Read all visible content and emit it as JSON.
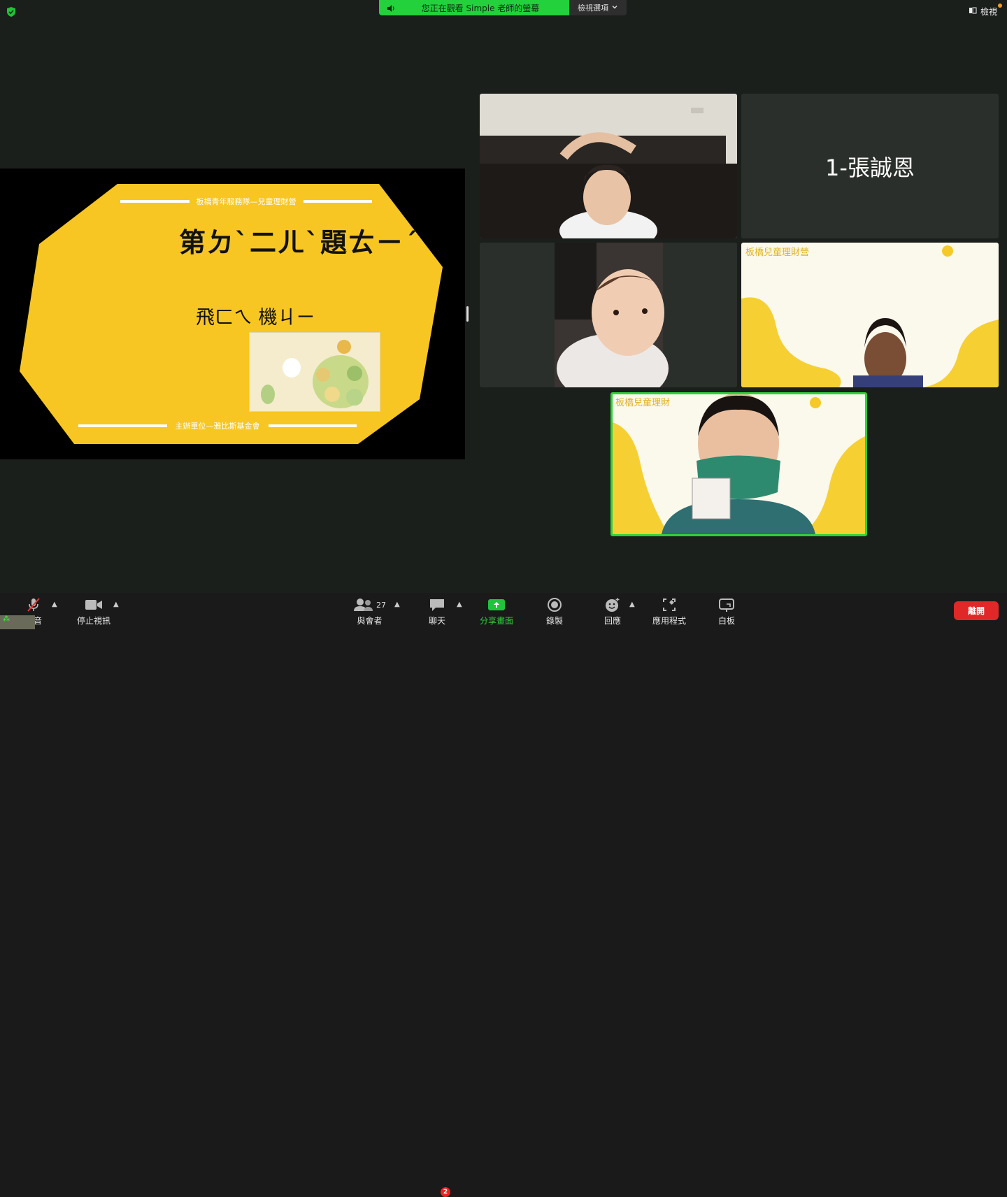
{
  "top": {
    "banner_text": "您正在觀看 Simple 老師的螢幕",
    "view_options": "檢視選項",
    "view_label": "檢視"
  },
  "slide": {
    "header": "板橋青年服務隊—兒童理財營",
    "title": "第ㄉˋ二ㄦˋ題ㄊㄧˊ",
    "word": "飛ㄈㄟ 機ㄐㄧ",
    "footer": "主辦單位—雅比斯基金會"
  },
  "participants": [
    {
      "type": "video",
      "name_hidden": true
    },
    {
      "type": "name",
      "name": "1-張誠恩"
    },
    {
      "type": "video",
      "name_hidden": true
    },
    {
      "type": "video",
      "bg_text": "板橋兒童理財營"
    },
    {
      "type": "video",
      "bg_text": "板橋兒童理財",
      "active": true
    }
  ],
  "toolbar": {
    "mute": "靜音",
    "stop_video": "停止視訊",
    "participants": "與會者",
    "participant_count": "27",
    "chat": "聊天",
    "chat_badge": "2",
    "share": "分享畫面",
    "record": "錄製",
    "reactions": "回應",
    "apps": "應用程式",
    "whiteboard": "白板",
    "leave": "離開"
  },
  "colors": {
    "banner_green": "#22d13c",
    "slide_yellow": "#f7c622",
    "leave_red": "#e02828",
    "active_speaker": "#2fd13a"
  }
}
